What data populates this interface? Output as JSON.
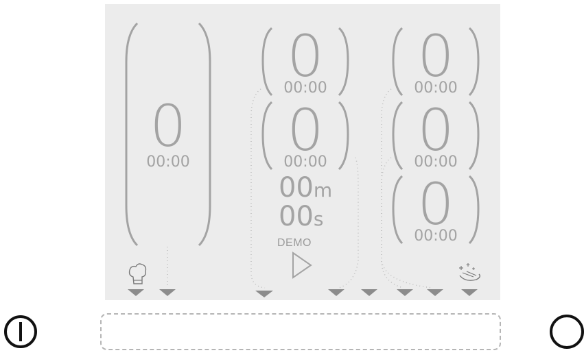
{
  "colors": {
    "panel": "#ececec",
    "ink": "#a3a3a3",
    "dots": "#bdbdbd",
    "arrow": "#8c8c8c",
    "power": "#111111"
  },
  "left_timer": {
    "count": "0",
    "time": "00:00"
  },
  "mid_timers": [
    {
      "count": "0",
      "time": "00:00"
    },
    {
      "count": "0",
      "time": "00:00"
    }
  ],
  "right_timers": [
    {
      "count": "0",
      "time": "00:00"
    },
    {
      "count": "0",
      "time": "00:00"
    },
    {
      "count": "0",
      "time": "00:00"
    }
  ],
  "countdown": {
    "minutes": "00",
    "minutes_unit": "m",
    "seconds": "00",
    "seconds_unit": "s"
  },
  "demo_label": "DEMO",
  "icons": {
    "left_corner": "chef-hat-icon",
    "right_corner": "sparkling-dish-icon",
    "play": "play-icon",
    "power": "power-icon",
    "circle": "circle-button-icon",
    "slot": "down-arrow-icon"
  },
  "footer_text": ""
}
